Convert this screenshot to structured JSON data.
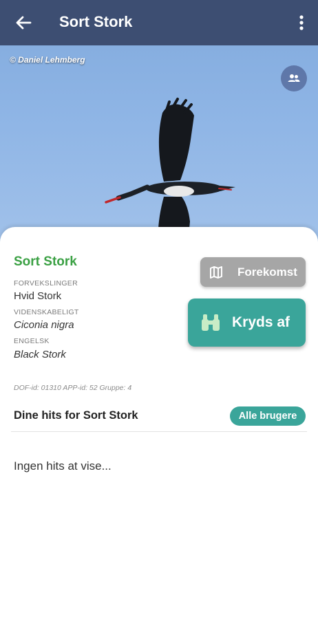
{
  "appbar": {
    "title": "Sort Stork"
  },
  "photo": {
    "credit": "© Daniel Lehmberg"
  },
  "species": {
    "name": "Sort Stork",
    "confusions_label": "FORVEKSLINGER",
    "confusions_value": "Hvid Stork",
    "scientific_label": "VIDENSKABELIGT",
    "scientific_value": "Ciconia nigra",
    "english_label": "ENGELSK",
    "english_value": "Black Stork",
    "meta": "DOF-id: 01310 APP-id: 52 Gruppe: 4"
  },
  "actions": {
    "forekomst_label": "Forekomst",
    "kryds_label": "Kryds af"
  },
  "hits": {
    "title": "Dine hits for Sort Stork",
    "filter_label": "Alle brugere",
    "empty_text": "Ingen hits at vise..."
  },
  "colors": {
    "appbar": "#3d4e72",
    "species_name": "#3aa043",
    "accent": "#3aa59a",
    "secondary_button": "#a6a6a6"
  }
}
